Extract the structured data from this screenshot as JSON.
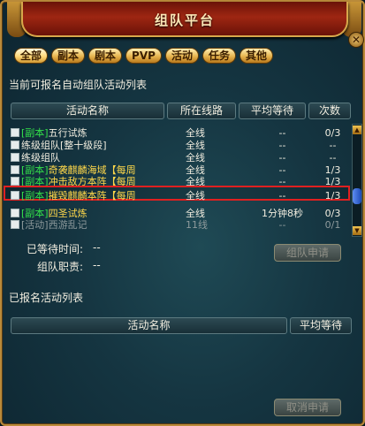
{
  "window": {
    "title": "组队平台",
    "close_icon": "close-icon"
  },
  "tabs": [
    {
      "label": "全部"
    },
    {
      "label": "副本"
    },
    {
      "label": "剧本"
    },
    {
      "label": "PVP"
    },
    {
      "label": "活动"
    },
    {
      "label": "任务"
    },
    {
      "label": "其他"
    }
  ],
  "available": {
    "section_title": "当前可报名自动组队活动列表",
    "columns": {
      "name": "活动名称",
      "line": "所在线路",
      "wait": "平均等待",
      "count": "次数"
    },
    "rows": [
      {
        "prefix": "[副本]",
        "name": "五行试炼",
        "line": "全线",
        "wait": "--",
        "count": "0/3"
      },
      {
        "prefix": "",
        "name": "练级组队[整十级段]",
        "line": "全线",
        "wait": "--",
        "count": "--"
      },
      {
        "prefix": "",
        "name": "练级组队",
        "line": "全线",
        "wait": "--",
        "count": "--"
      },
      {
        "prefix": "[副本]",
        "name": "奇袭麒麟海域【每周",
        "line": "全线",
        "wait": "--",
        "count": "1/3"
      },
      {
        "prefix": "[副本]",
        "name": "冲击敌方本阵【每周",
        "line": "全线",
        "wait": "--",
        "count": "1/3"
      },
      {
        "prefix": "[副本]",
        "name": "摧毁麒麟本阵【每周",
        "line": "全线",
        "wait": "--",
        "count": "1/3"
      },
      {
        "prefix": "[副本]",
        "name": "四圣试炼",
        "line": "全线",
        "wait": "1分钟8秒",
        "count": "0/3"
      },
      {
        "prefix": "[活动]",
        "name": "西游乱记",
        "line": "11线",
        "wait": "--",
        "count": "0/1"
      }
    ]
  },
  "status": {
    "wait_label": "已等待时间:",
    "wait_value": "--",
    "role_label": "组队职责:",
    "role_value": "--",
    "apply_button": "组队申请"
  },
  "registered": {
    "section_title": "已报名活动列表",
    "columns": {
      "name": "活动名称",
      "wait": "平均等待"
    },
    "cancel_button": "取消申请"
  },
  "colors": {
    "dungeon_prefix": "#33e04a",
    "highlight_name": "#ffd84a",
    "selection_border": "#e02020",
    "disabled_row": "#8e9a9c"
  }
}
